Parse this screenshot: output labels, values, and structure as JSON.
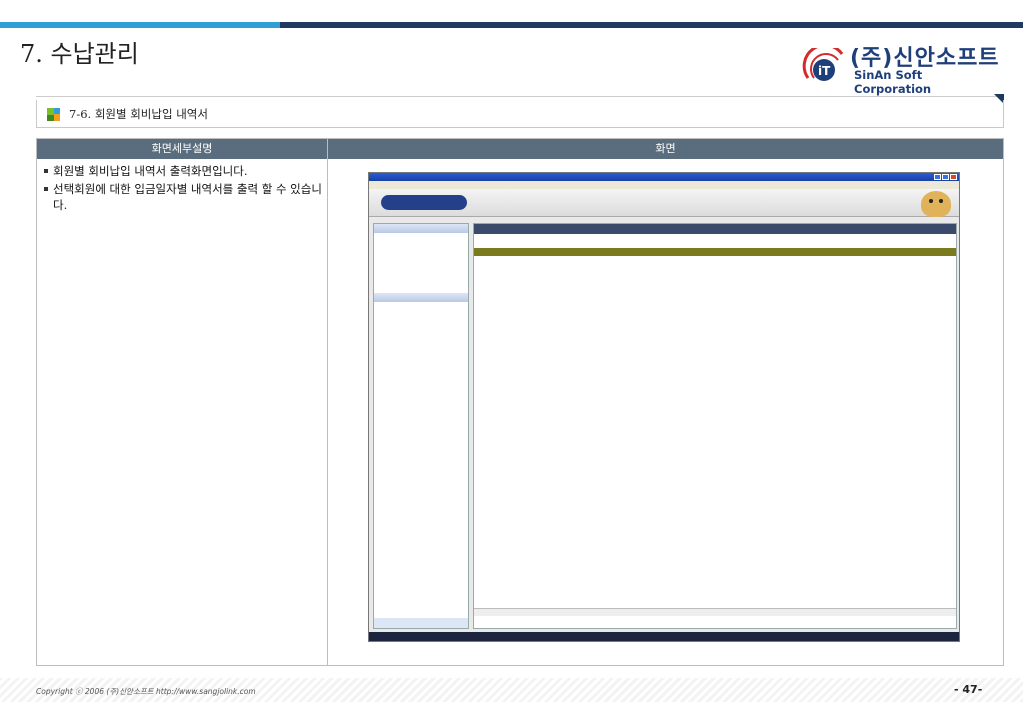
{
  "header": {
    "title": "7. 수납관리"
  },
  "logo": {
    "korean": "(주)신안소프트",
    "english": "SinAn Soft Corporation"
  },
  "section": {
    "title": "7-6. 회원별 회비납입 내역서"
  },
  "table": {
    "col_desc_header": "화면세부설명",
    "col_screen_header": "화면",
    "descriptions": [
      "회원별 회비납입 내역서 출력화면입니다.",
      "선택회원에 대한 입금일자별 내역서를 출력 할 수 있습니다."
    ]
  },
  "footer": {
    "copyright": "Copyright ⓒ 2006 (주)신안소프트  http://www.sangjolink.com",
    "page_number": "- 47-"
  },
  "colors": {
    "nav_dark": "#1f3a5e",
    "nav_accent": "#2f9fd6",
    "header_cell": "#5a6d7e",
    "logo_blue": "#1f3f7a"
  }
}
